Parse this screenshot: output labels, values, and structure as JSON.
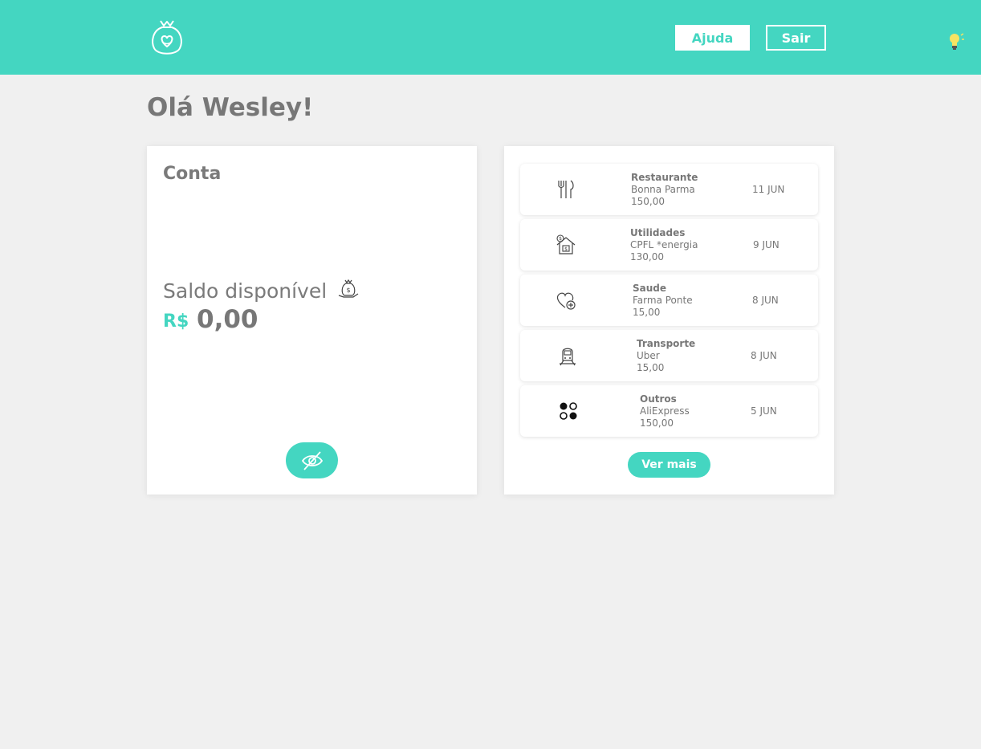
{
  "header": {
    "logo_icon": "smiling-money-bag-logo-icon",
    "help_label": "Ajuda",
    "exit_label": "Sair",
    "theme_icon": "lightbulb-icon",
    "accent_color": "#44d6c1"
  },
  "greeting": "Olá Wesley!",
  "account": {
    "title": "Conta",
    "balance_label": "Saldo disponível",
    "balance_icon": "money-bag-hand-icon",
    "currency": "R$",
    "balance": "0,00",
    "toggle_icon": "eye-slash-icon"
  },
  "transactions": {
    "items": [
      {
        "category": "Restaurante",
        "merchant": "Bonna Parma",
        "amount": "150,00",
        "date": "11 JUN",
        "icon": "fork-knife-icon"
      },
      {
        "category": "Utilidades",
        "merchant": "CPFL *energia",
        "amount": "130,00",
        "date": "9 JUN",
        "icon": "house-bill-icon"
      },
      {
        "category": "Saude",
        "merchant": "Farma Ponte",
        "amount": "15,00",
        "date": "8 JUN",
        "icon": "heart-plus-icon"
      },
      {
        "category": "Transporte",
        "merchant": "Uber",
        "amount": "15,00",
        "date": "8 JUN",
        "icon": "train-icon"
      },
      {
        "category": "Outros",
        "merchant": "AliExpress",
        "amount": "150,00",
        "date": "5 JUN",
        "icon": "four-dots-icon"
      }
    ],
    "more_label": "Ver mais"
  }
}
